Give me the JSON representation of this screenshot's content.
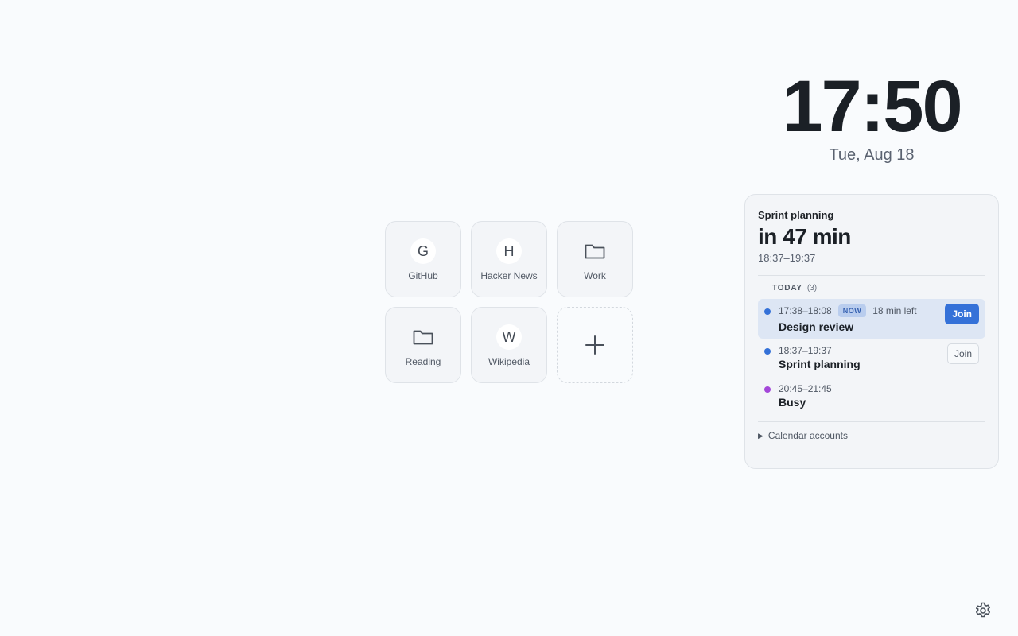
{
  "clock": {
    "time": "17:50",
    "date": "Tue, Aug 18"
  },
  "shortcuts": [
    {
      "label": "GitHub",
      "icon_letter": "G",
      "icon": "letter-icon"
    },
    {
      "label": "Hacker News",
      "icon_letter": "H",
      "icon": "letter-icon"
    },
    {
      "label": "Work",
      "icon": "folder-icon"
    },
    {
      "label": "Reading",
      "icon": "folder-icon"
    },
    {
      "label": "Wikipedia",
      "icon_letter": "W",
      "icon": "letter-icon"
    },
    {
      "label": "+",
      "icon": "plus-icon"
    }
  ],
  "calendar": {
    "next": {
      "title": "Sprint planning",
      "countdown": "in 47 min",
      "time": "18:37–19:37"
    },
    "section": {
      "label": "TODAY",
      "count": "(3)"
    },
    "events": [
      {
        "time": "17:38–18:08",
        "badge": "NOW",
        "remaining": "18 min left",
        "title": "Design review",
        "join": "Join",
        "color": "#3471d8"
      },
      {
        "time": "18:37–19:37",
        "title": "Sprint planning",
        "join": "Join",
        "color": "#3471d8"
      },
      {
        "time": "20:45–21:45",
        "title": "Busy",
        "color": "#a347d9"
      }
    ],
    "accounts_label": "Calendar accounts"
  },
  "colors": {
    "accent": "#3471d8",
    "background": "#f9fbfd",
    "busy": "#a347d9"
  }
}
